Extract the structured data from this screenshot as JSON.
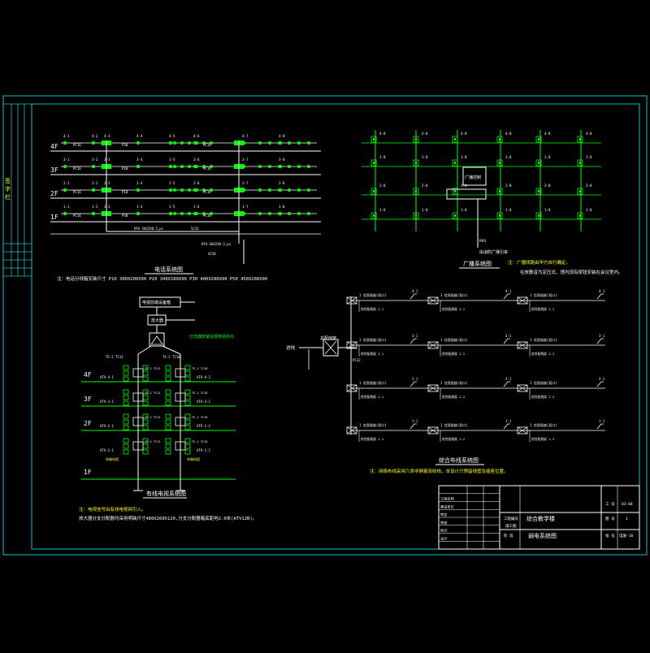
{
  "colors": {
    "background": "#000000",
    "frame": "#00c8c8",
    "line": "#ffffff",
    "green": "#00ff00",
    "yellow": "#ffff00",
    "magenta": "#ff00ff"
  },
  "phone": {
    "floors": [
      "4F",
      "3F",
      "2F",
      "1F"
    ],
    "title": "电话系统图",
    "note": "注：电话分线箱安装尺寸 P10 300X200X90 P20 340X180X90 P30 400X280X90 P50 450X280X90",
    "cable_a": "HYA-50X2X0.5,pc",
    "cable_b": "SC32",
    "cable_c": "HYA-20X2X0.5,pc",
    "cable_d": "SC50",
    "floor_labels": {
      "4F": [
        "4-1",
        "4-2",
        "4-3",
        "4-4",
        "4-5",
        "4-6",
        "4-7",
        "4-8"
      ],
      "3F": [
        "3-1",
        "3-2",
        "3-3",
        "3-4",
        "3-5",
        "3-6",
        "3-7",
        "3-8"
      ],
      "2F": [
        "2-1",
        "2-2",
        "2-3",
        "2-4",
        "2-5",
        "2-6",
        "2-7",
        "2-8"
      ],
      "1F": [
        "1-1",
        "1-2",
        "1-3",
        "1-4",
        "1-5",
        "1-6",
        "1-7",
        "1-8"
      ]
    },
    "box_labels": [
      "P30",
      "P20",
      "P10"
    ],
    "conduit": "PC16"
  },
  "broadcast": {
    "title": "广播系统图",
    "box": "广播控制",
    "row_labels": [
      "4-8",
      "3-8",
      "2-8",
      "1-8"
    ],
    "note1": "注：广播线路由甲方自行确定。",
    "note2": "在放散音为定压式，馆内现有按钮安装在会议室内。",
    "feed": "RVS",
    "source": "由消防广播引来"
  },
  "tv": {
    "title": "有线电视系统图",
    "floors": [
      "4F",
      "3F",
      "2F",
      "1F"
    ],
    "top_box": "电视前端设备箱",
    "amp": "放大器",
    "splitter_note": "分支器安装在弱电竖井内",
    "outlet_labels_left": [
      "ATV-4-1",
      "ATV-3-1",
      "ATV-2-1",
      "ATV-1-1"
    ],
    "outlet_labels_right": [
      "ATV-4-2",
      "ATV-3-2",
      "ATV-2-2",
      "ATV-1-2"
    ],
    "feed": "TV",
    "note1": "注：电视信号由有线电视网引入。",
    "note2": "放大器分支分配器均采用明装尺寸480X260X120,分支分配器箱底距地2.0米(ATV12B)。",
    "left_tags": [
      "TS-2 TC12",
      "TS-2 TC12",
      "TS-2 TC12",
      "TS-2 TC12"
    ],
    "right_tags": [
      "TS-2 TC10",
      "TS-2 TC10",
      "TS-2 TC10",
      "TS-2 TC10"
    ],
    "top_right_tag": "TS-2 TC10",
    "top_left_tag": "TS-2 TC12",
    "end_left": "终端电阻",
    "end_right": "终端电阻"
  },
  "network": {
    "title": "综合布线系统图",
    "note": "注：网络布线采用六类非屏蔽双绞线，本设计只预留线管及插座位置。",
    "rows": [
      {
        "tag": "4-1",
        "items": [
          "1 信息插座(双口)",
          "1 信息插座(双口)",
          "1 信息插座(双口)"
        ],
        "sub": [
          "综合配线架 4-1",
          "综合配线架 4-2",
          "综合配线架 4-3"
        ]
      },
      {
        "tag": "3-1",
        "items": [
          "1 信息插座(双口)",
          "1 信息插座(双口)",
          "1 信息插座(双口)"
        ],
        "sub": [
          "综合配线架 3-1",
          "综合配线架 3-2",
          "综合配线架 3-3"
        ]
      },
      {
        "tag": "2-1",
        "items": [
          "1 信息插座(双口)",
          "1 信息插座(双口)",
          "1 信息插座(双口)"
        ],
        "sub": [
          "综合配线架 2-1",
          "综合配线架 2-2",
          "综合配线架 2-3"
        ]
      },
      {
        "tag": "1-1",
        "items": [
          "1 信息插座(双口)",
          "1 信息插座(双口)",
          "1 信息插座(双口)"
        ],
        "sub": [
          "综合配线架 1-1",
          "综合配线架 1-2",
          "综合配线架 1-3"
        ]
      }
    ],
    "entry": "进线",
    "trunk": "PC32",
    "main_label": "总配线架"
  },
  "titleblock": {
    "project": "综合教学楼",
    "drawing": "弱电系统图",
    "rows_left": [
      "工程名称",
      "建设单位",
      "审定",
      "审核",
      "校对",
      "设计"
    ],
    "field_a": "工程编号",
    "field_b": "图 号",
    "label_stage": "阶 段",
    "label_scale": "比 例",
    "val_stage": "施工图",
    "val_num": "1",
    "val_code": "电施-10",
    "label_pages": "张 号",
    "right_top": "工 号",
    "right_val": "03-08",
    "date_label": "日 期"
  },
  "sidebar": [
    "签",
    "字",
    "栏"
  ]
}
